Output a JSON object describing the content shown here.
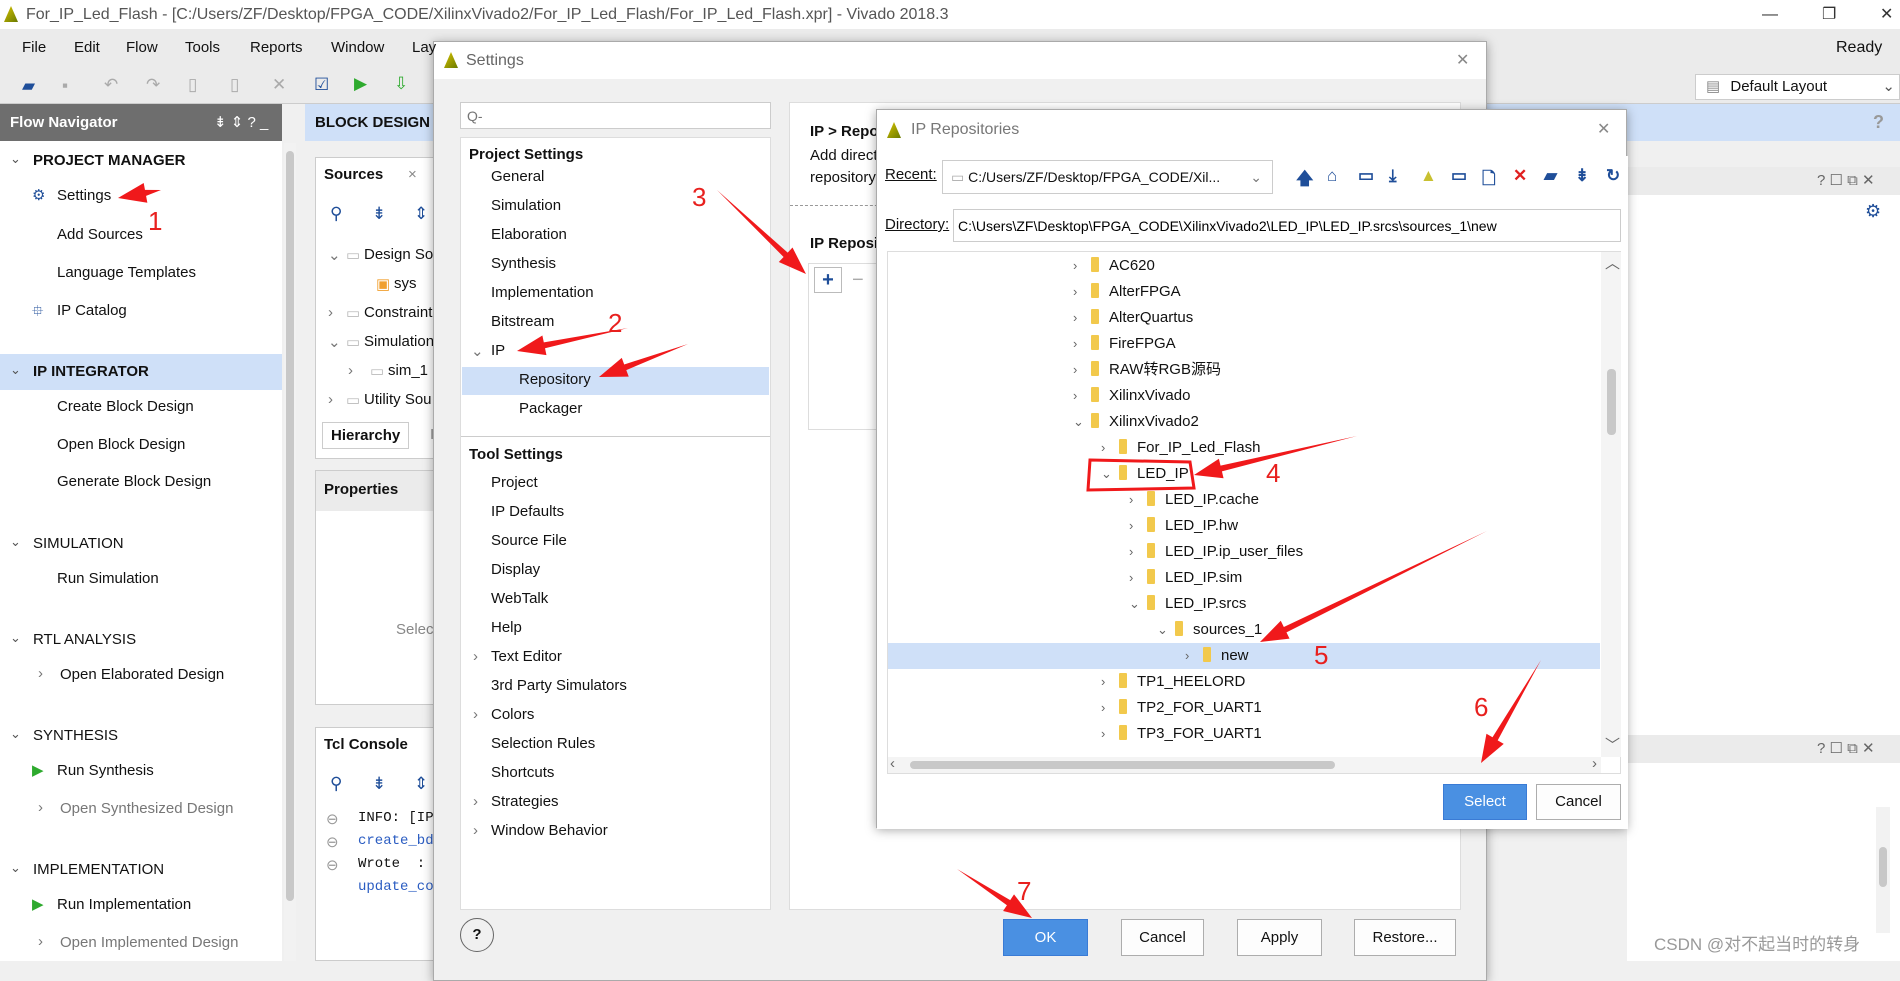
{
  "window": {
    "title": "For_IP_Led_Flash - [C:/Users/ZF/Desktop/FPGA_CODE/XilinxVivado2/For_IP_Led_Flash/For_IP_Led_Flash.xpr] - Vivado 2018.3",
    "status": "Ready",
    "layout_select": "Default Layout"
  },
  "menu": [
    "File",
    "Edit",
    "Flow",
    "Tools",
    "Reports",
    "Window",
    "Lay"
  ],
  "flow_navigator": {
    "title": "Flow Navigator",
    "items": [
      {
        "label": "PROJECT MANAGER",
        "type": "section"
      },
      {
        "label": "Settings",
        "type": "item",
        "icon": "gear-icon"
      },
      {
        "label": "Add Sources",
        "type": "item"
      },
      {
        "label": "Language Templates",
        "type": "item"
      },
      {
        "label": "IP Catalog",
        "type": "item",
        "icon": "ip-catalog-icon"
      },
      {
        "label": "IP INTEGRATOR",
        "type": "section",
        "selected": true
      },
      {
        "label": "Create Block Design",
        "type": "item"
      },
      {
        "label": "Open Block Design",
        "type": "item"
      },
      {
        "label": "Generate Block Design",
        "type": "item"
      },
      {
        "label": "SIMULATION",
        "type": "section"
      },
      {
        "label": "Run Simulation",
        "type": "item"
      },
      {
        "label": "RTL ANALYSIS",
        "type": "section"
      },
      {
        "label": "Open Elaborated Design",
        "type": "item",
        "chevron": true
      },
      {
        "label": "SYNTHESIS",
        "type": "section"
      },
      {
        "label": "Run Synthesis",
        "type": "item",
        "icon": "run-icon"
      },
      {
        "label": "Open Synthesized Design",
        "type": "item",
        "chevron": true,
        "disabled": true
      },
      {
        "label": "IMPLEMENTATION",
        "type": "section"
      },
      {
        "label": "Run Implementation",
        "type": "item",
        "icon": "run-icon"
      },
      {
        "label": "Open Implemented Design",
        "type": "item",
        "chevron": true,
        "disabled": true
      }
    ]
  },
  "block_design": {
    "title": "BLOCK DESIGN"
  },
  "sources": {
    "tab": "Sources",
    "tree": [
      "Design So",
      "sys",
      "Constraint",
      "Simulation",
      "sim_1",
      "Utility Sou"
    ],
    "tabs": [
      "Hierarchy",
      "IP"
    ]
  },
  "properties": {
    "title": "Properties",
    "hint": "Selec"
  },
  "tcl": {
    "title": "Tcl Console",
    "lines": [
      {
        "text": "INFO: [IP_",
        "color": "#111"
      },
      {
        "text": "create_bd_",
        "color": "#2a5cc2"
      },
      {
        "text": "Wrote  : <",
        "color": "#111"
      },
      {
        "text": "update_cor",
        "color": "#2a5cc2"
      }
    ]
  },
  "settings": {
    "title": "Settings",
    "search_placeholder": "Q-",
    "project_header": "Project Settings",
    "project_items": [
      {
        "label": "General"
      },
      {
        "label": "Simulation"
      },
      {
        "label": "Elaboration"
      },
      {
        "label": "Synthesis"
      },
      {
        "label": "Implementation"
      },
      {
        "label": "Bitstream"
      },
      {
        "label": "IP",
        "chevron": "down",
        "level": 0
      },
      {
        "label": "Repository",
        "level": 1,
        "selected": true
      },
      {
        "label": "Packager",
        "level": 1
      }
    ],
    "tool_header": "Tool Settings",
    "tool_items": [
      {
        "label": "Project"
      },
      {
        "label": "IP Defaults"
      },
      {
        "label": "Source File"
      },
      {
        "label": "Display"
      },
      {
        "label": "WebTalk"
      },
      {
        "label": "Help"
      },
      {
        "label": "Text Editor",
        "chevron": "right"
      },
      {
        "label": "3rd Party Simulators"
      },
      {
        "label": "Colors",
        "chevron": "right"
      },
      {
        "label": "Selection Rules"
      },
      {
        "label": "Shortcuts"
      },
      {
        "label": "Strategies",
        "chevron": "right"
      },
      {
        "label": "Window Behavior",
        "chevron": "right"
      }
    ],
    "right": {
      "breadcrumb": "IP > Repo",
      "desc1": "Add directo",
      "desc2": "repository.",
      "section": "IP Reposi",
      "add": "+",
      "remove": "−"
    },
    "buttons": {
      "help": "?",
      "ok": "OK",
      "cancel": "Cancel",
      "apply": "Apply",
      "restore": "Restore..."
    }
  },
  "ip_repos": {
    "title": "IP Repositories",
    "recent_label": "Recent:",
    "recent_value": "C:/Users/ZF/Desktop/FPGA_CODE/Xil...",
    "directory_label": "Directory:",
    "directory_value": "C:\\Users\\ZF\\Desktop\\FPGA_CODE\\XilinxVivado2\\LED_IP\\LED_IP.srcs\\sources_1\\new",
    "toolbar_icons": [
      "up-icon",
      "home-icon",
      "desktop-icon",
      "download-icon",
      "vivado-icon",
      "monitor-icon",
      "new-file-icon",
      "delete-icon",
      "new-folder-icon",
      "collapse-icon",
      "refresh-icon"
    ],
    "tree": [
      {
        "label": "AC620",
        "level": 0,
        "expanded": false
      },
      {
        "label": "AlterFPGA",
        "level": 0,
        "expanded": false
      },
      {
        "label": "AlterQuartus",
        "level": 0,
        "expanded": false
      },
      {
        "label": "FireFPGA",
        "level": 0,
        "expanded": false
      },
      {
        "label": "RAW转RGB源码",
        "level": 0,
        "expanded": false
      },
      {
        "label": "XilinxVivado",
        "level": 0,
        "expanded": false
      },
      {
        "label": "XilinxVivado2",
        "level": 0,
        "expanded": true
      },
      {
        "label": "For_IP_Led_Flash",
        "level": 1,
        "expanded": false
      },
      {
        "label": "LED_IP",
        "level": 1,
        "expanded": true
      },
      {
        "label": "LED_IP.cache",
        "level": 2,
        "expanded": false
      },
      {
        "label": "LED_IP.hw",
        "level": 2,
        "expanded": false
      },
      {
        "label": "LED_IP.ip_user_files",
        "level": 2,
        "expanded": false
      },
      {
        "label": "LED_IP.sim",
        "level": 2,
        "expanded": false
      },
      {
        "label": "LED_IP.srcs",
        "level": 2,
        "expanded": true
      },
      {
        "label": "sources_1",
        "level": 3,
        "expanded": true
      },
      {
        "label": "new",
        "level": 4,
        "expanded": false,
        "selected": true
      },
      {
        "label": "TP1_HEELORD",
        "level": 1,
        "expanded": false
      },
      {
        "label": "TP2_FOR_UART1",
        "level": 1,
        "expanded": false
      },
      {
        "label": "TP3_FOR_UART1",
        "level": 1,
        "expanded": false
      }
    ],
    "buttons": {
      "select": "Select",
      "cancel": "Cancel"
    }
  },
  "annotations": [
    "1",
    "2",
    "3",
    "4",
    "5",
    "6",
    "7"
  ],
  "watermark": "CSDN @对不起当时的转身",
  "colors": {
    "accent": "#4a90e2",
    "selection": "#cfe0f8",
    "annotation": "#f0191b",
    "folder": "#f2c94c"
  }
}
